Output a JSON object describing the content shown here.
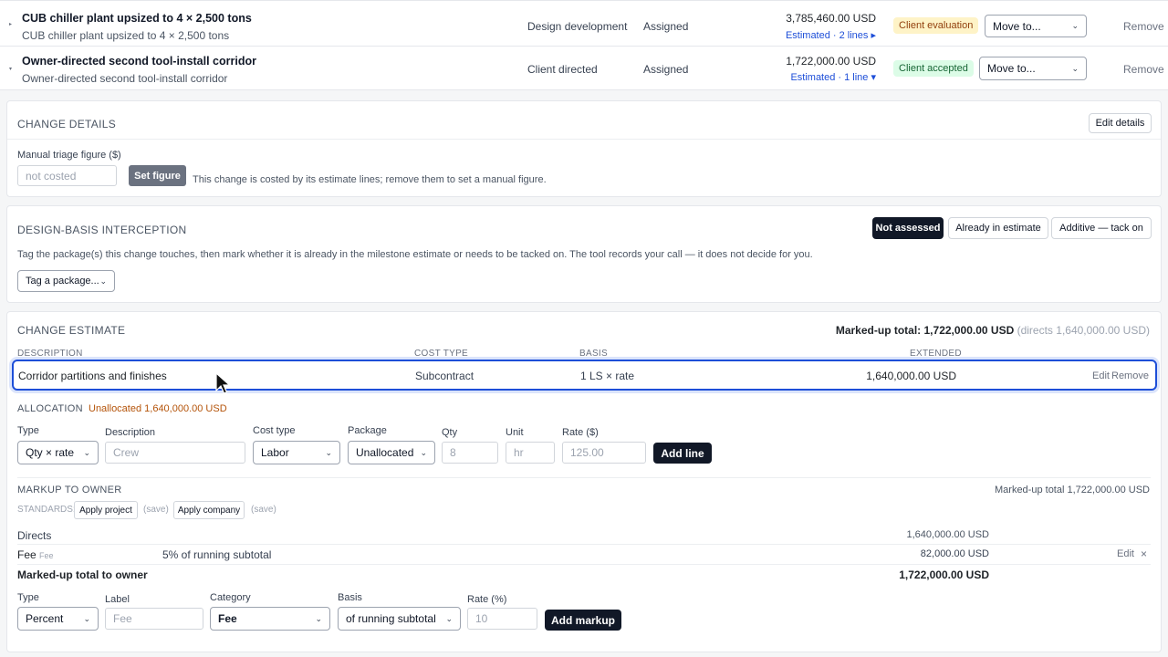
{
  "changes": [
    {
      "title": "CUB chiller plant upsized to 4 × 2,500 tons",
      "subtitle": "CUB chiller plant upsized to 4 × 2,500 tons",
      "phase": "Design development",
      "assignment": "Assigned",
      "amount": "3,785,460.00 USD",
      "estimate_link": "Estimated · 2 lines ▸",
      "status": "Client evaluation",
      "move_to": "Move to...",
      "remove": "Remove"
    },
    {
      "title": "Owner-directed second tool-install corridor",
      "subtitle": "Owner-directed second tool-install corridor",
      "phase": "Client directed",
      "assignment": "Assigned",
      "amount": "1,722,000.00 USD",
      "estimate_link": "Estimated · 1 line ▾",
      "status": "Client accepted",
      "move_to": "Move to...",
      "remove": "Remove"
    }
  ],
  "change_details": {
    "title": "CHANGE DETAILS",
    "edit_button": "Edit details",
    "manual_label": "Manual triage figure ($)",
    "manual_placeholder": "not costed",
    "set_figure": "Set figure",
    "note": "This change is costed by its estimate lines; remove them to set a manual figure."
  },
  "design_basis": {
    "title": "DESIGN-BASIS INTERCEPTION",
    "options": [
      "Not assessed",
      "Already in estimate",
      "Additive — tack on"
    ],
    "description": "Tag the package(s) this change touches, then mark whether it is already in the milestone estimate or needs to be tacked on. The tool records your call — it does not decide for you.",
    "tag_select": "Tag a package..."
  },
  "estimate": {
    "title": "CHANGE ESTIMATE",
    "total_label": "Marked-up total: 1,722,000.00 USD",
    "total_directs": "(directs 1,640,000.00 USD)",
    "columns": [
      "DESCRIPTION",
      "COST TYPE",
      "BASIS",
      "EXTENDED"
    ],
    "line": {
      "description": "Corridor partitions and finishes",
      "cost_type": "Subcontract",
      "basis": "1 LS × rate",
      "extended": "1,640,000.00 USD",
      "edit": "Edit",
      "remove": "Remove"
    },
    "allocation_label": "ALLOCATION",
    "unallocated": "Unallocated 1,640,000.00 USD",
    "form": {
      "type_label": "Type",
      "type_value": "Qty × rate",
      "desc_label": "Description",
      "desc_placeholder": "Crew",
      "cost_type_label": "Cost type",
      "cost_type_value": "Labor",
      "package_label": "Package",
      "package_value": "Unallocated",
      "qty_label": "Qty",
      "qty_placeholder": "8",
      "unit_label": "Unit",
      "unit_placeholder": "hr",
      "rate_label": "Rate ($)",
      "rate_placeholder": "125.00",
      "add_line": "Add line"
    }
  },
  "markup": {
    "title": "MARKUP TO OWNER",
    "total_right": "Marked-up total 1,722,000.00 USD",
    "standards_label": "STANDARDS:",
    "apply_project": "Apply project",
    "apply_company": "Apply company",
    "save": "(save)",
    "directs_label": "Directs",
    "directs_value": "1,640,000.00 USD",
    "fee_label": "Fee",
    "fee_tag": "Fee",
    "fee_desc": "5% of running subtotal",
    "fee_value": "82,000.00 USD",
    "fee_edit": "Edit",
    "fee_remove": "×",
    "owner_total_label": "Marked-up total to owner",
    "owner_total_value": "1,722,000.00 USD",
    "form": {
      "type_label": "Type",
      "type_value": "Percent",
      "label_label": "Label",
      "label_placeholder": "Fee",
      "category_label": "Category",
      "category_value": "Fee",
      "basis_label": "Basis",
      "basis_value": "of running subtotal",
      "rate_label": "Rate (%)",
      "rate_placeholder": "10",
      "add_markup": "Add markup"
    }
  },
  "colors": {
    "accent_blue": "#1d4ed8",
    "dark_button": "#111827",
    "warning_text": "#b45309"
  }
}
